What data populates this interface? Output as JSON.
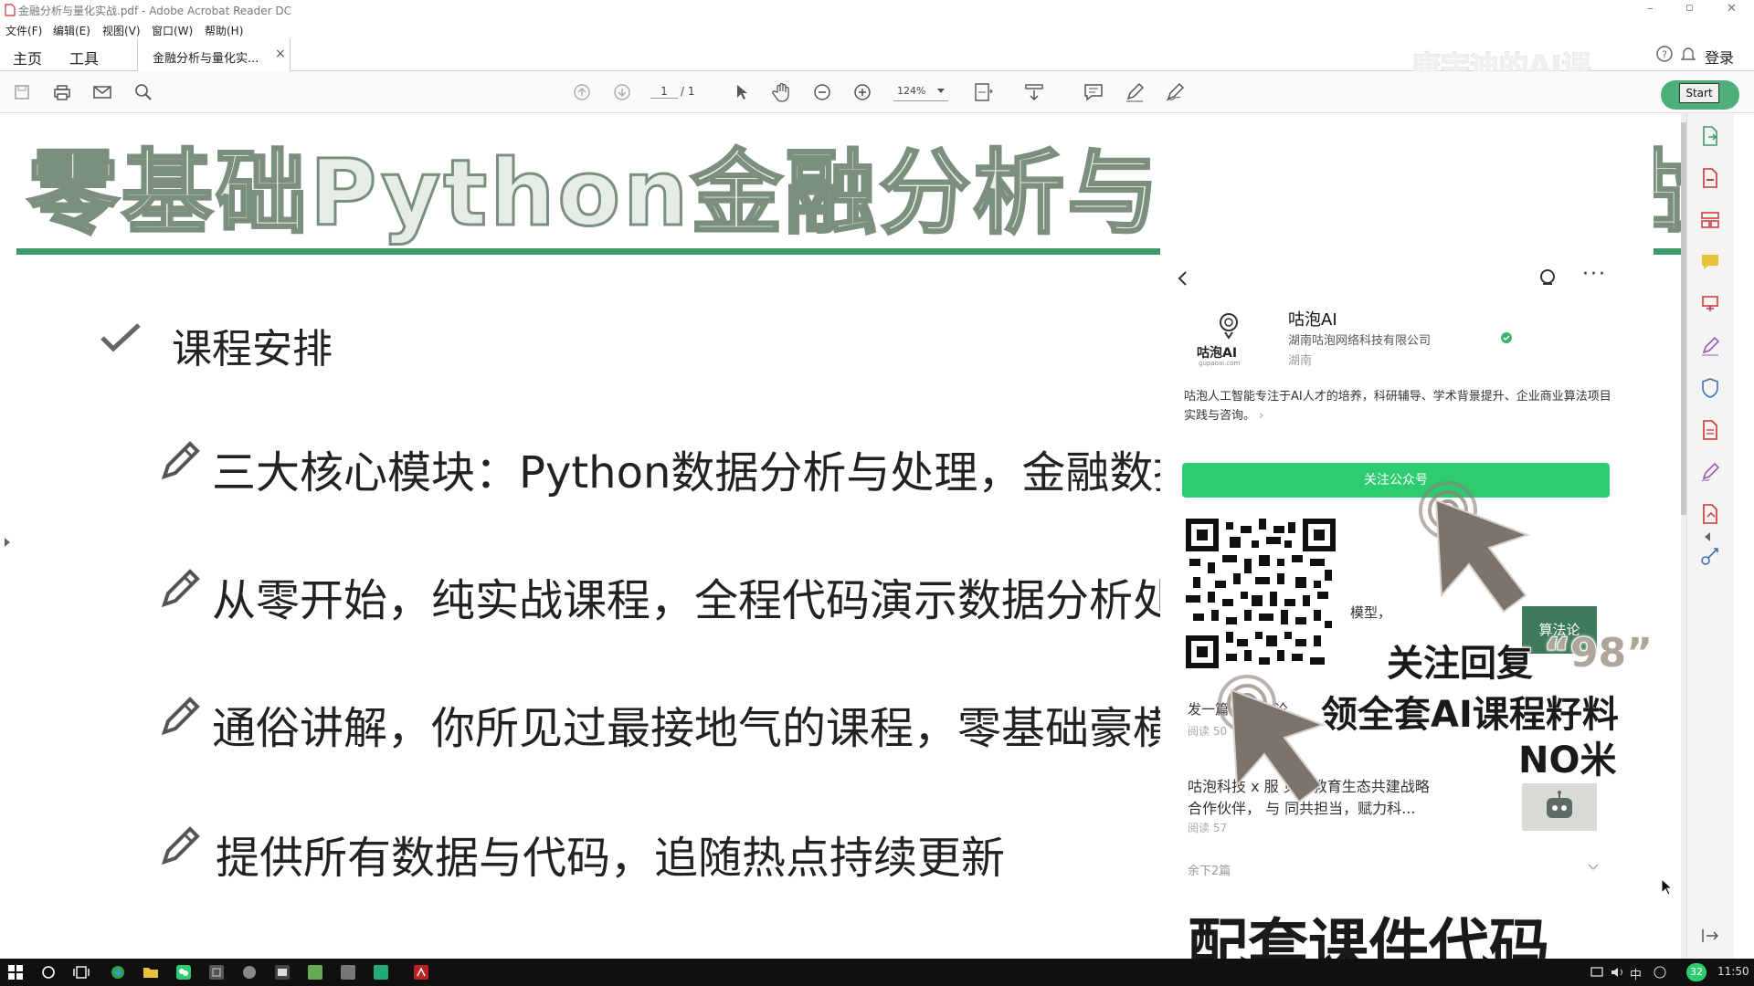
{
  "window": {
    "title": "金融分析与量化实战.pdf - Adobe Acrobat Reader DC",
    "controls": {
      "minimize": "–",
      "maximize": "▫",
      "close": "✕"
    }
  },
  "menu": [
    "文件(F)",
    "编辑(E)",
    "视图(V)",
    "窗口(W)",
    "帮助(H)"
  ],
  "tabs": {
    "home": "主页",
    "tools": "工具",
    "doc": "金融分析与量化实...",
    "close": "×",
    "login": "登录"
  },
  "toolbar": {
    "page_current": "1",
    "page_total": "/ 1",
    "zoom": "124%",
    "start_label": "Start"
  },
  "slide": {
    "title": "零基础Python金融分析与量化交易实战",
    "section": "课程安排",
    "bullets": [
      "三大核心模块：Python数据分析与处理，金融数据分",
      "从零开始，纯实战课程，全程代码演示数据分析处理",
      "通俗讲解，你所见过最接地气的课程，零基础豪横无",
      "提供所有数据与代码，追随热点持续更新"
    ],
    "accent_color": "#3d9a6a"
  },
  "wechat": {
    "logo_text": "咕泡AI",
    "logo_sub": "gupaoai.com",
    "name": "咕泡AI",
    "company": "湖南咕泡网络科技有限公司",
    "region": "湖南",
    "desc": "咕泡人工智能专注于AI人才的培养，科研辅导、学术背景提升、企业商业算法项目实践与咨询。",
    "desc_arrow": "›",
    "follow_button": "关注公众号",
    "snippet_model": "模型，",
    "article1_title": "发一篇 CCF-A论",
    "article1_reads": "阅读 50",
    "article2_title_line1": "咕泡科技 x 服 见云教育生态共建战略",
    "article2_title_line2": "合作伙伴， 与 同共担当，赋力科...",
    "article2_reads": "阅读 57",
    "remaining": "余下2篇",
    "thumb_label": "算法论"
  },
  "overlay": {
    "watermark": "唐宇迪的AI课",
    "promo_line1": "关注回复",
    "promo_quote": "“98”",
    "promo_line2": "领全套AI课程籽料",
    "promo_line3": "NO米",
    "caption": "配套课件代码"
  },
  "taskbar": {
    "tray_lang": "中",
    "tray_badge": "32",
    "time": "11:50"
  }
}
